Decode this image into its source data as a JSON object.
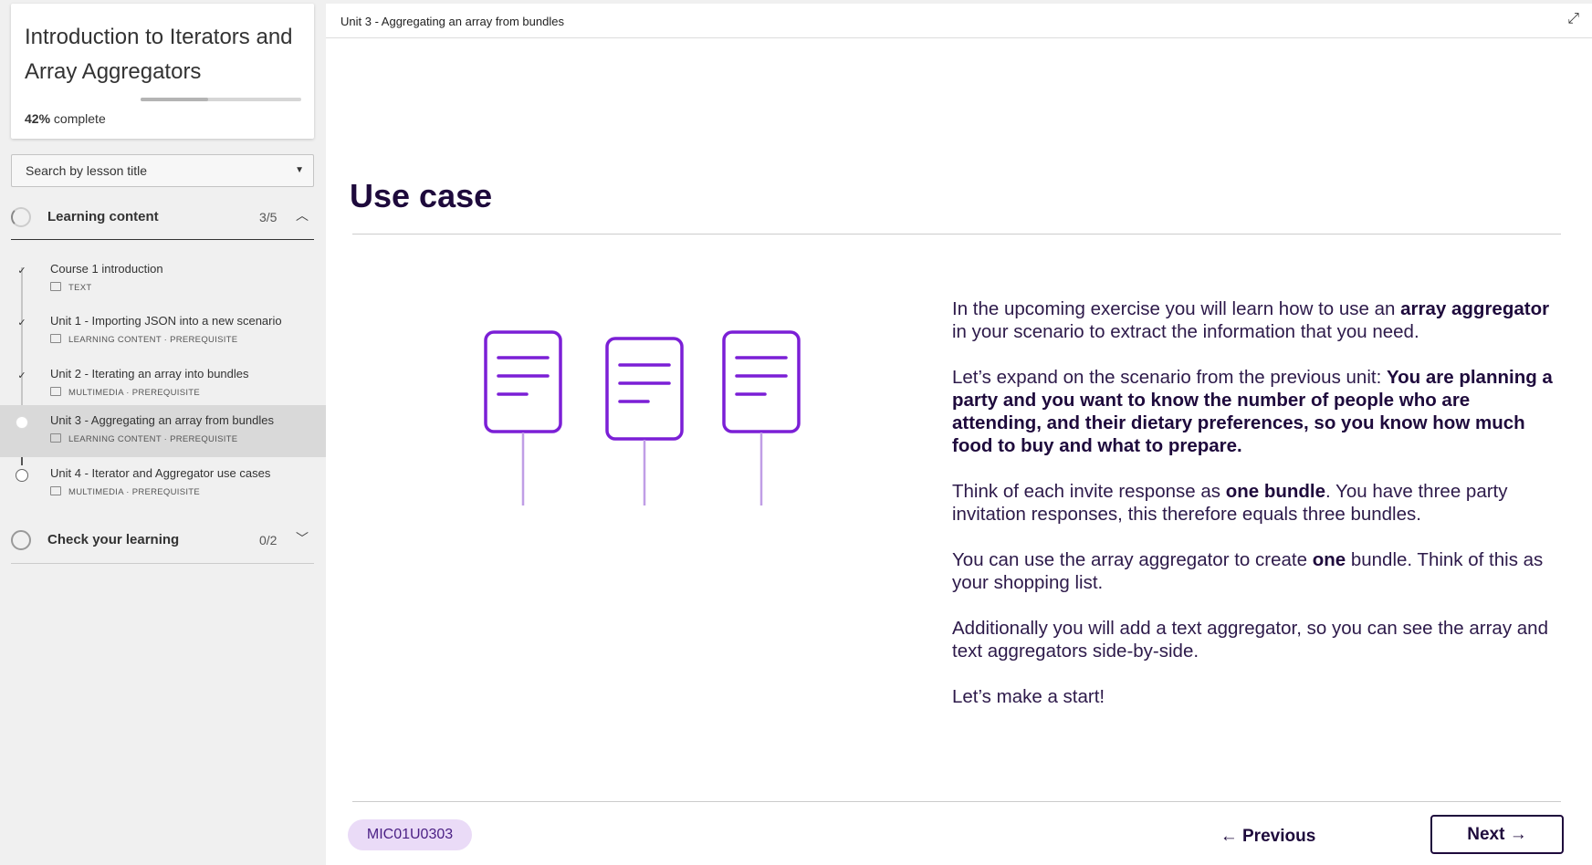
{
  "course": {
    "title": "Introduction to Iterators and Array Aggregators",
    "progress_percent": "42%",
    "progress_suffix": "complete",
    "progress_value": 0.42
  },
  "search": {
    "placeholder": "Search by lesson title"
  },
  "sections": [
    {
      "label": "Learning content",
      "count": "3/5",
      "expanded": true,
      "lessons": [
        {
          "title": "Course 1 introduction",
          "meta": "TEXT",
          "status": "done"
        },
        {
          "title": "Unit 1 - Importing JSON into a new scenario",
          "meta": "LEARNING CONTENT · PREREQUISITE",
          "status": "done"
        },
        {
          "title": "Unit 2 - Iterating an array into bundles",
          "meta": "MULTIMEDIA · PREREQUISITE",
          "status": "done"
        },
        {
          "title": "Unit 3 - Aggregating an array from bundles",
          "meta": "LEARNING CONTENT · PREREQUISITE",
          "status": "current"
        },
        {
          "title": "Unit 4 - Iterator and Aggregator use cases",
          "meta": "MULTIMEDIA · PREREQUISITE",
          "status": "todo"
        }
      ]
    },
    {
      "label": "Check your learning",
      "count": "0/2",
      "expanded": false
    }
  ],
  "main": {
    "breadcrumb": "Unit 3 - Aggregating an array from bundles",
    "page_title": "Use case",
    "paragraphs": [
      {
        "parts": [
          {
            "t": "In the upcoming exercise you will learn how to use an ",
            "b": false
          },
          {
            "t": "array aggregator",
            "b": true
          },
          {
            "t": " in your scenario to extract the information that you need.",
            "b": false
          }
        ]
      },
      {
        "parts": [
          {
            "t": "Let’s expand on the scenario from the previous unit: ",
            "b": false
          },
          {
            "t": "You are planning a party and you want to know the number of people who are attending, and their dietary preferences, so you know how much food to buy and what to prepare.",
            "b": true
          }
        ]
      },
      {
        "parts": [
          {
            "t": "Think of each invite response as ",
            "b": false
          },
          {
            "t": "one bundle",
            "b": true
          },
          {
            "t": ". You have three party invitation responses, this therefore equals three bundles.",
            "b": false
          }
        ]
      },
      {
        "parts": [
          {
            "t": "You can use the array aggregator to create ",
            "b": false
          },
          {
            "t": "one",
            "b": true
          },
          {
            "t": " bundle. Think of this as your shopping list.",
            "b": false
          }
        ]
      },
      {
        "parts": [
          {
            "t": "Additionally you will add a text aggregator, so you can see the array and text aggregators side-by-side.",
            "b": false
          }
        ]
      },
      {
        "parts": [
          {
            "t": "Let’s make a start!",
            "b": false
          }
        ]
      }
    ],
    "code": "MIC01U0303",
    "previous_label": "Previous",
    "next_label": "Next"
  },
  "icons": {
    "check": "✓",
    "caret_down": "▼",
    "chevron_up": "︿",
    "chevron_down": "﹀",
    "expand": "⤢",
    "arrow_left": "←",
    "arrow_right": "→"
  },
  "colors": {
    "accent": "#7b1fd6",
    "heading": "#1e0a3c",
    "badge_bg": "#eadbf7"
  }
}
